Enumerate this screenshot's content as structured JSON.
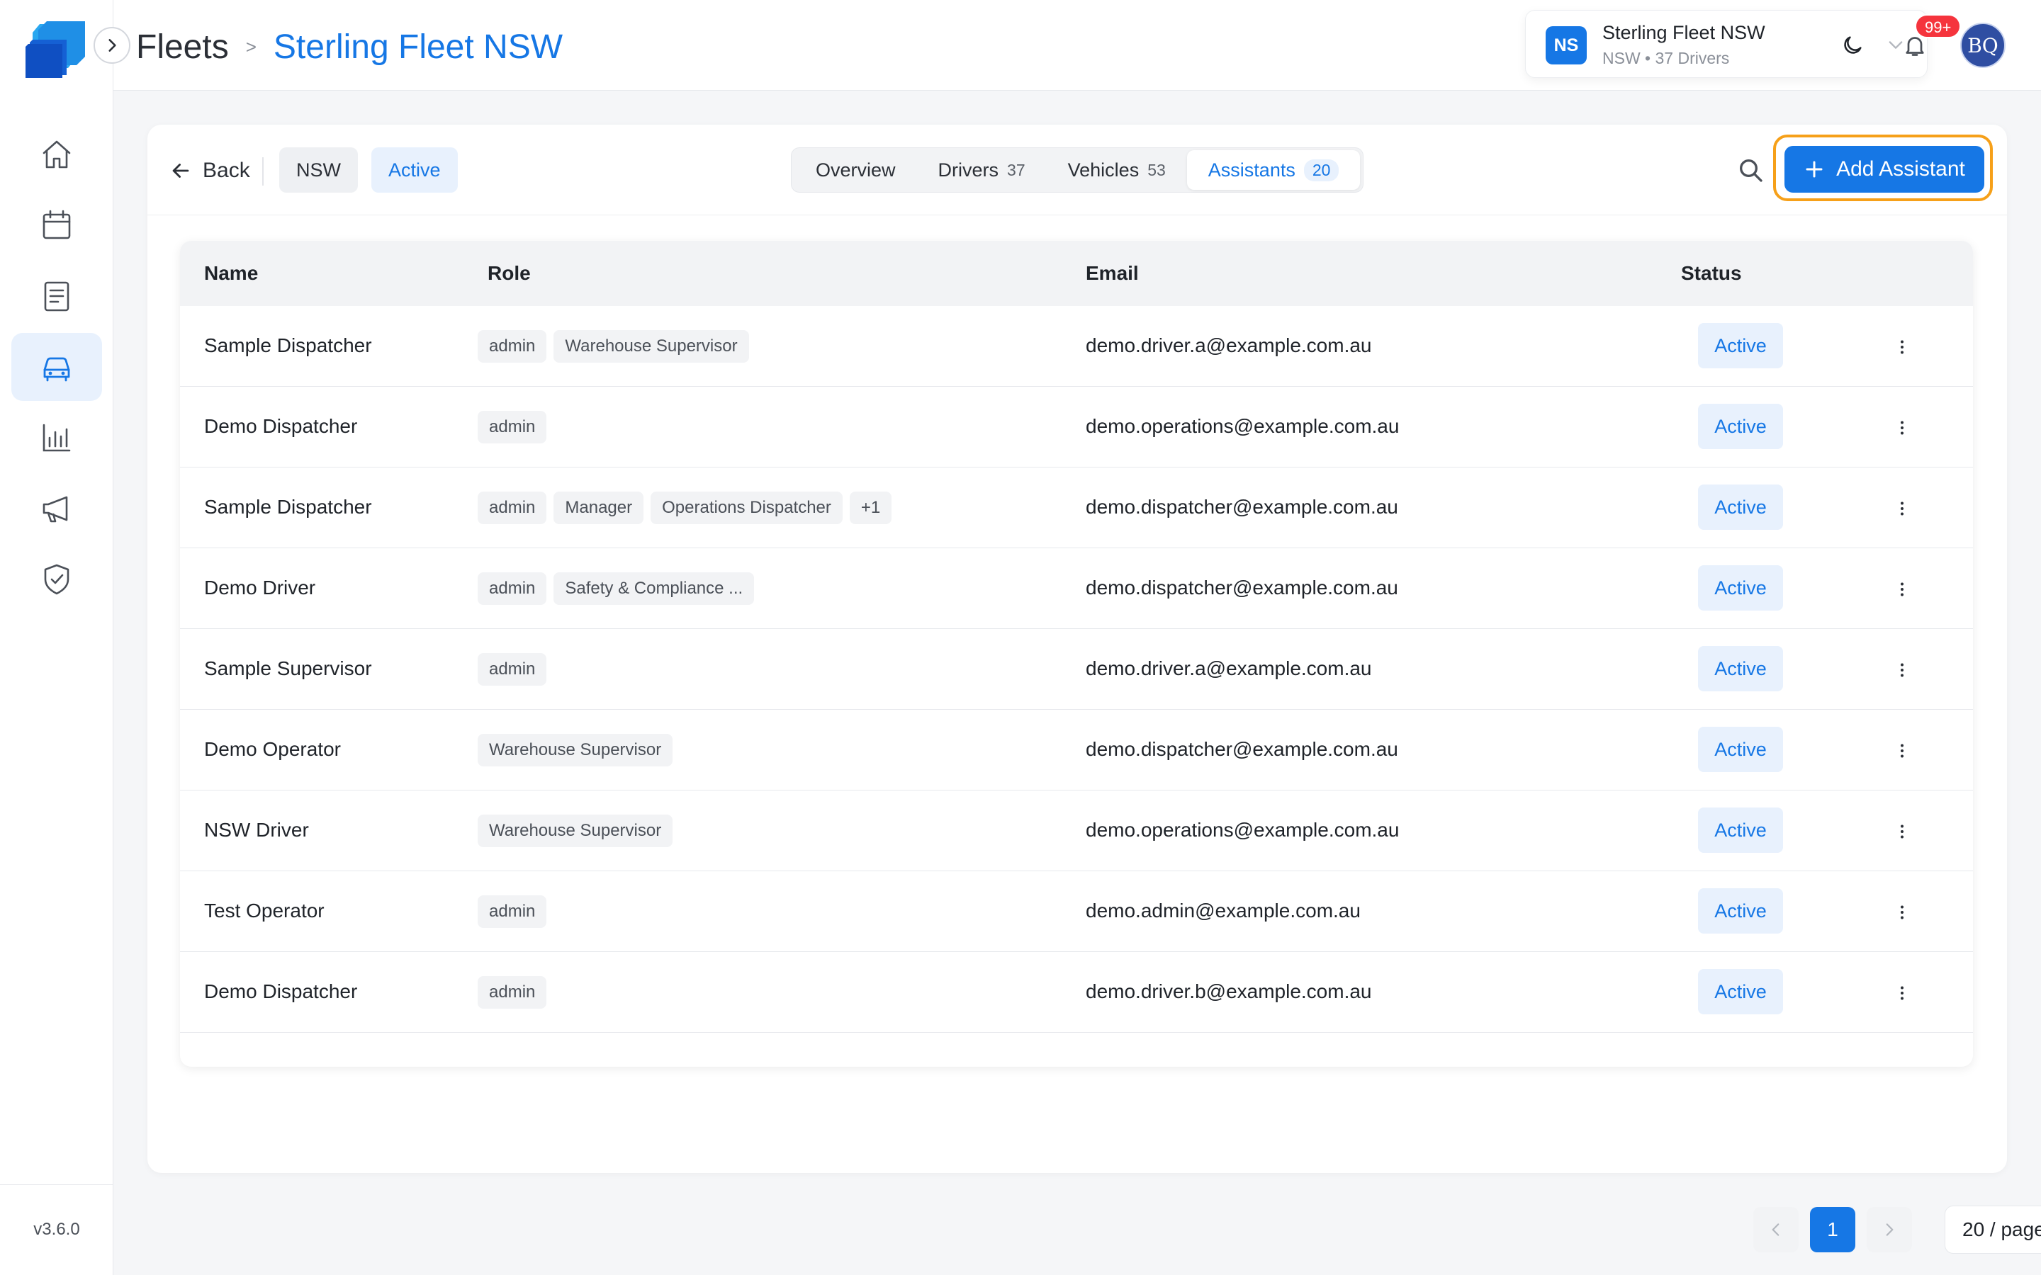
{
  "app": {
    "version": "v3.6.0"
  },
  "sidebar": {
    "items": [
      {
        "icon": "home-icon",
        "active": false
      },
      {
        "icon": "calendar-icon",
        "active": false
      },
      {
        "icon": "document-list-icon",
        "active": false
      },
      {
        "icon": "car-icon",
        "active": true
      },
      {
        "icon": "bar-chart-icon",
        "active": false
      },
      {
        "icon": "megaphone-icon",
        "active": false
      },
      {
        "icon": "shield-check-icon",
        "active": false
      }
    ]
  },
  "header": {
    "breadcrumb_root": "Fleets",
    "breadcrumb_sep": ">",
    "breadcrumb_current": "Sterling Fleet NSW",
    "fleet_switcher": {
      "initials": "NS",
      "name": "Sterling Fleet NSW",
      "subtitle": "NSW • 37 Drivers"
    },
    "notification_badge": "99+",
    "user_initials": "BQ"
  },
  "toolbar": {
    "back_label": "Back",
    "region_chip": "NSW",
    "status_chip": "Active",
    "tabs": [
      {
        "label": "Overview",
        "count": "",
        "active": false
      },
      {
        "label": "Drivers",
        "count": "37",
        "active": false
      },
      {
        "label": "Vehicles",
        "count": "53",
        "active": false
      },
      {
        "label": "Assistants",
        "count": "20",
        "active": true
      }
    ],
    "add_button_label": "Add Assistant"
  },
  "table": {
    "columns": {
      "name": "Name",
      "role": "Role",
      "email": "Email",
      "status": "Status"
    },
    "rows": [
      {
        "name": "Sample Dispatcher",
        "roles": [
          "admin",
          "Warehouse Supervisor"
        ],
        "email": "demo.driver.a@example.com.au",
        "status": "Active"
      },
      {
        "name": "Demo Dispatcher",
        "roles": [
          "admin"
        ],
        "email": "demo.operations@example.com.au",
        "status": "Active"
      },
      {
        "name": "Sample Dispatcher",
        "roles": [
          "admin",
          "Manager",
          "Operations Dispatcher",
          "+1"
        ],
        "email": "demo.dispatcher@example.com.au",
        "status": "Active"
      },
      {
        "name": "Demo Driver",
        "roles": [
          "admin",
          "Safety & Compliance ..."
        ],
        "email": "demo.dispatcher@example.com.au",
        "status": "Active"
      },
      {
        "name": "Sample Supervisor",
        "roles": [
          "admin"
        ],
        "email": "demo.driver.a@example.com.au",
        "status": "Active"
      },
      {
        "name": "Demo Operator",
        "roles": [
          "Warehouse Supervisor"
        ],
        "email": "demo.dispatcher@example.com.au",
        "status": "Active"
      },
      {
        "name": "NSW Driver",
        "roles": [
          "Warehouse Supervisor"
        ],
        "email": "demo.operations@example.com.au",
        "status": "Active"
      },
      {
        "name": "Test Operator",
        "roles": [
          "admin"
        ],
        "email": "demo.admin@example.com.au",
        "status": "Active"
      },
      {
        "name": "Demo Dispatcher",
        "roles": [
          "admin"
        ],
        "email": "demo.driver.b@example.com.au",
        "status": "Active"
      }
    ]
  },
  "pagination": {
    "current_page": "1",
    "page_size_label": "20 / page"
  },
  "colors": {
    "accent": "#1677e5",
    "highlight": "#f6a019",
    "badge": "#f5343d"
  }
}
